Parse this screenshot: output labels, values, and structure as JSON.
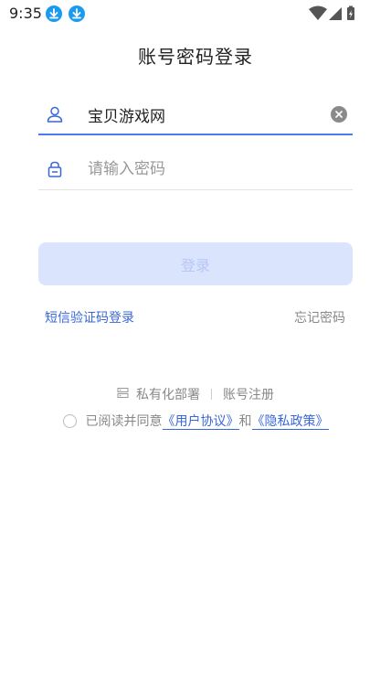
{
  "status_bar": {
    "time": "9:35",
    "icons": [
      "download-icon",
      "download-icon",
      "wifi-icon",
      "signal-icon",
      "battery-charging-icon"
    ]
  },
  "page": {
    "title": "账号密码登录"
  },
  "form": {
    "account": {
      "value": "宝贝游戏网",
      "icon": "user-icon"
    },
    "password": {
      "placeholder": "请输入密码",
      "icon": "lock-icon"
    },
    "login_label": "登录"
  },
  "links": {
    "sms_login": "短信验证码登录",
    "forgot_password": "忘记密码"
  },
  "bottom": {
    "private_deploy": "私有化部署",
    "register": "账号注册"
  },
  "agreement": {
    "prefix": "已阅读并同意",
    "user_agreement": "《用户协议》",
    "and": "和",
    "privacy_policy": "《隐私政策》"
  },
  "colors": {
    "accent": "#3a67d8",
    "input_active_line": "#4a7cf0",
    "login_button_bg": "#dbe4fd",
    "download_badge": "#1a9bf0"
  }
}
